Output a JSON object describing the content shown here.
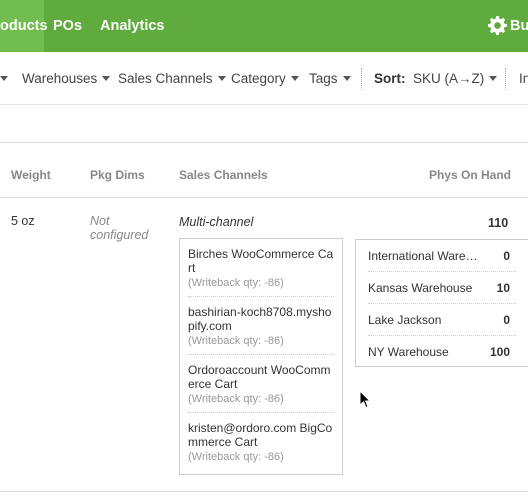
{
  "nav": {
    "items": [
      {
        "label": "oducts",
        "active": true
      },
      {
        "label": "POs",
        "active": false
      },
      {
        "label": "Analytics",
        "active": false
      }
    ],
    "right_label": "Bu",
    "right_icon": "gear-icon"
  },
  "filters": {
    "items": [
      "Warehouses",
      "Sales Channels",
      "Category",
      "Tags"
    ],
    "sort_label": "Sort:",
    "sort_value": "SKU (A→Z)",
    "overflow_label": "In"
  },
  "table": {
    "headers": {
      "weight": "Weight",
      "pkg_dims": "Pkg Dims",
      "sales_channels": "Sales Channels",
      "phys_on_hand": "Phys On Hand"
    },
    "row": {
      "weight": "5 oz",
      "pkg_dims_line1": "Not",
      "pkg_dims_line2": "configured",
      "sales_channels": "Multi-channel",
      "phys_on_hand": "110"
    }
  },
  "channels": [
    {
      "name": "Birches WooCommerce Cart",
      "writeback": "(Writeback qty: -86)"
    },
    {
      "name": "bashirian-koch8708.myshopify.com",
      "writeback": "(Writeback qty: -86)"
    },
    {
      "name": "Ordoroaccount WooCommerce Cart",
      "writeback": "(Writeback qty: -86)"
    },
    {
      "name": "kristen@ordoro.com BigCommerce Cart",
      "writeback": "(Writeback qty: -86)"
    }
  ],
  "warehouses": [
    {
      "name": "International Warehouse",
      "qty": "0"
    },
    {
      "name": "Kansas Warehouse",
      "qty": "10"
    },
    {
      "name": "Lake Jackson",
      "qty": "0"
    },
    {
      "name": "NY Warehouse",
      "qty": "100"
    }
  ],
  "colors": {
    "nav_bg": "#60ab3d",
    "nav_active": "#72bd4f"
  }
}
